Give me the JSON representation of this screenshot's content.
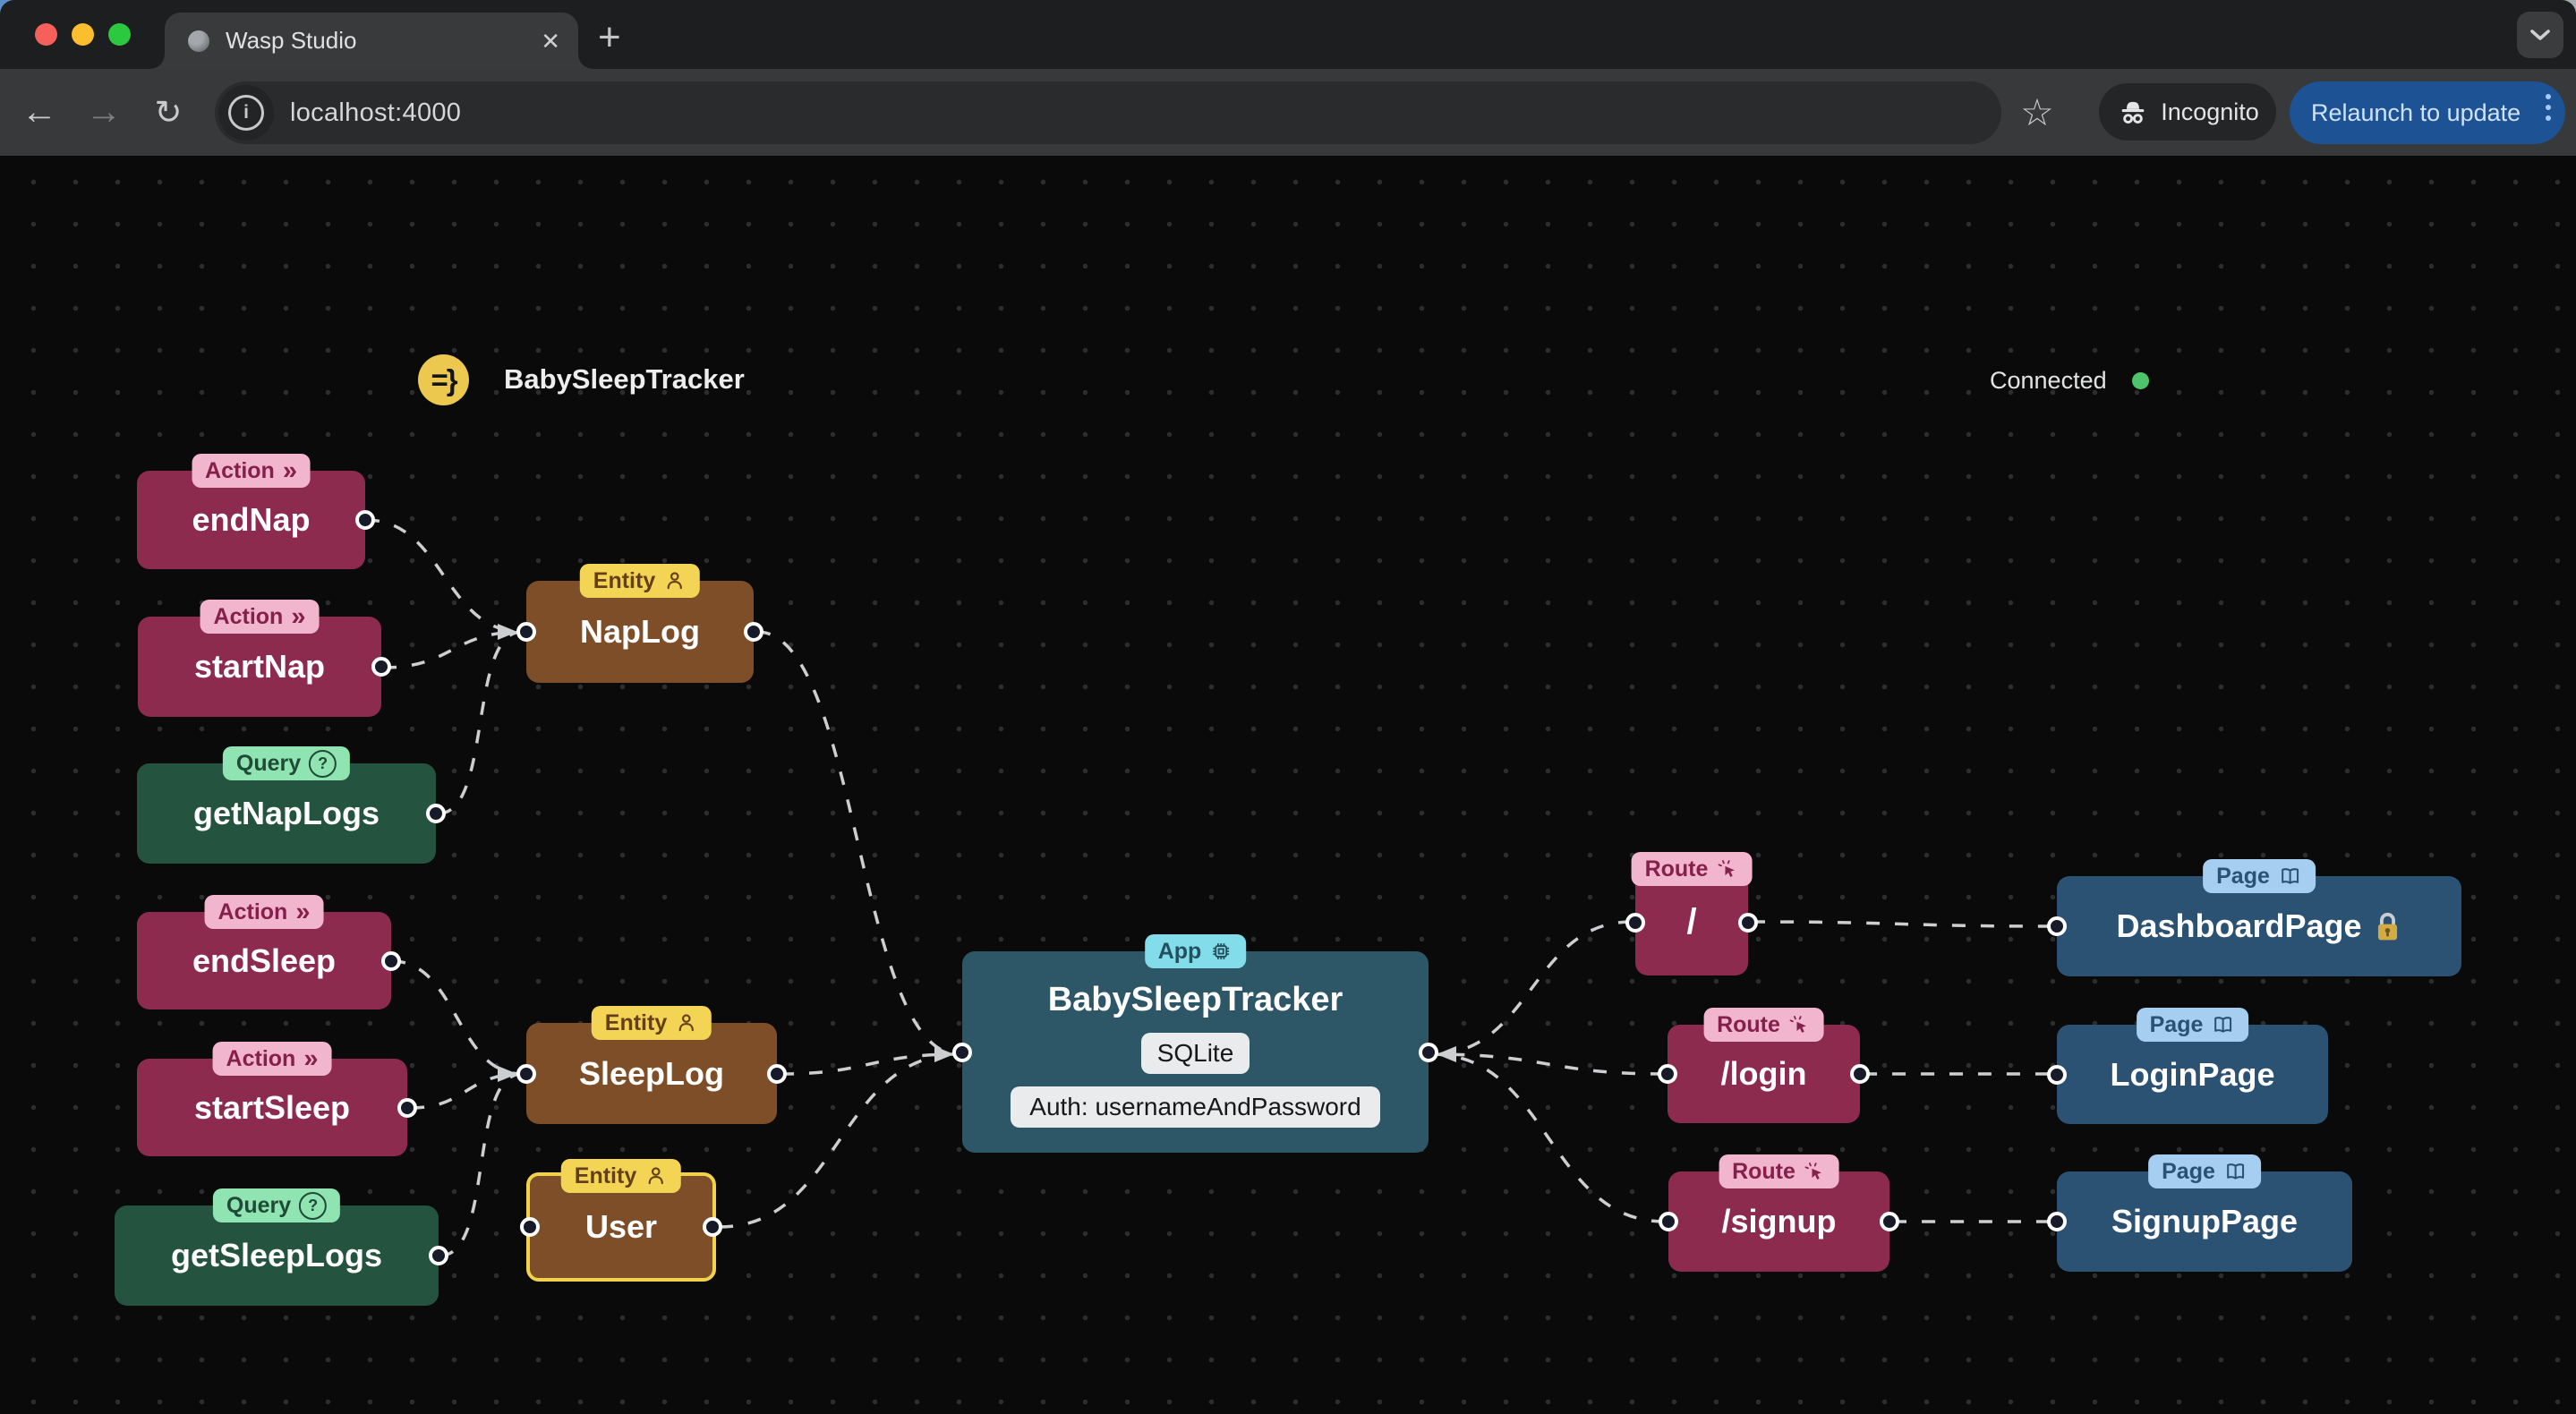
{
  "browser": {
    "tab_title": "Wasp Studio",
    "close_tab_glyph": "✕",
    "new_tab_glyph": "+",
    "back_glyph": "←",
    "forward_glyph": "→",
    "reload_glyph": "↻",
    "url": "localhost:4000",
    "star_glyph": "☆",
    "incognito_label": "Incognito",
    "relaunch_button_label": "Relaunch to update",
    "accent_blue": "#1d5294"
  },
  "header": {
    "logo_glyph": "=}",
    "app_name": "BabySleepTracker",
    "status": "Connected",
    "status_color": "#4ec46a"
  },
  "icons": {
    "action_glyph": "»",
    "query_glyph": "?"
  },
  "nodes": {
    "endNap": {
      "badge": "Action",
      "label": "endNap"
    },
    "startNap": {
      "badge": "Action",
      "label": "startNap"
    },
    "getNapLogs": {
      "badge": "Query",
      "label": "getNapLogs"
    },
    "endSleep": {
      "badge": "Action",
      "label": "endSleep"
    },
    "startSleep": {
      "badge": "Action",
      "label": "startSleep"
    },
    "getSleepLogs": {
      "badge": "Query",
      "label": "getSleepLogs"
    },
    "napLog": {
      "badge": "Entity",
      "label": "NapLog"
    },
    "sleepLog": {
      "badge": "Entity",
      "label": "SleepLog"
    },
    "user": {
      "badge": "Entity",
      "label": "User",
      "selected": true
    },
    "app": {
      "badge": "App",
      "label": "BabySleepTracker",
      "database": "SQLite",
      "auth": "Auth: usernameAndPassword"
    },
    "routeRoot": {
      "badge": "Route",
      "label": "/"
    },
    "routeLogin": {
      "badge": "Route",
      "label": "/login"
    },
    "routeSignup": {
      "badge": "Route",
      "label": "/signup"
    },
    "dashboardPage": {
      "badge": "Page",
      "label": "DashboardPage",
      "auth_protected": true
    },
    "loginPage": {
      "badge": "Page",
      "label": "LoginPage"
    },
    "signupPage": {
      "badge": "Page",
      "label": "SignupPage"
    }
  },
  "edges": [
    {
      "from": "endNap",
      "to": "napLog"
    },
    {
      "from": "startNap",
      "to": "napLog"
    },
    {
      "from": "getNapLogs",
      "to": "napLog"
    },
    {
      "from": "napLog",
      "to": "app"
    },
    {
      "from": "endSleep",
      "to": "sleepLog"
    },
    {
      "from": "startSleep",
      "to": "sleepLog"
    },
    {
      "from": "getSleepLogs",
      "to": "sleepLog"
    },
    {
      "from": "sleepLog",
      "to": "app"
    },
    {
      "from": "user",
      "to": "app"
    },
    {
      "from": "routeRoot",
      "to": "app"
    },
    {
      "from": "routeLogin",
      "to": "app"
    },
    {
      "from": "routeSignup",
      "to": "app"
    },
    {
      "from": "routeRoot",
      "to": "dashboardPage"
    },
    {
      "from": "routeLogin",
      "to": "loginPage"
    },
    {
      "from": "routeSignup",
      "to": "signupPage"
    }
  ],
  "colors": {
    "action_route_node": "#8d2b4f",
    "query_node": "#24543f",
    "entity_node": "#7d4e28",
    "app_node": "#2d5766",
    "page_node": "#2b5173",
    "selection_yellow": "#f2d24b",
    "edge_gray": "#cdced0"
  }
}
